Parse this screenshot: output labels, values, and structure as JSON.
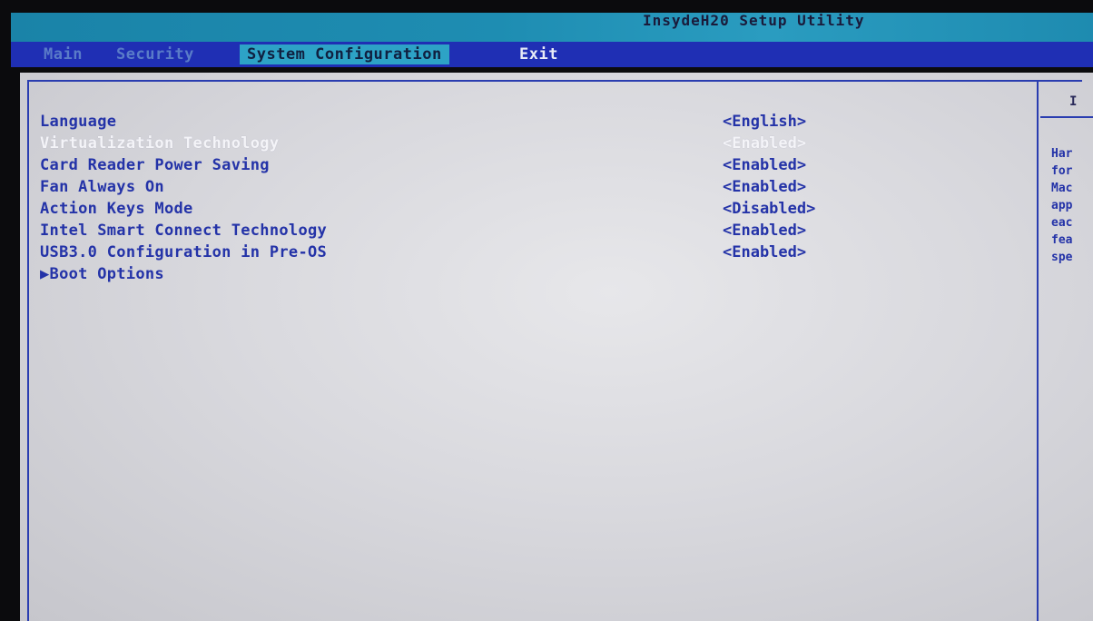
{
  "app": {
    "title": "InsydeH20 Setup Utility"
  },
  "menu": {
    "tabs": [
      {
        "label": "Main"
      },
      {
        "label": "Security"
      },
      {
        "label": "System Configuration"
      },
      {
        "label": "Exit"
      }
    ],
    "active": "System Configuration"
  },
  "settings": [
    {
      "label": "Language",
      "value": "<English>"
    },
    {
      "label": "Virtualization Technology",
      "value": "<Enabled>"
    },
    {
      "label": "Card Reader Power Saving",
      "value": "<Enabled>"
    },
    {
      "label": "Fan Always On",
      "value": "<Enabled>"
    },
    {
      "label": "Action Keys Mode",
      "value": "<Disabled>"
    },
    {
      "label": "Intel Smart Connect Technology",
      "value": "<Enabled>"
    },
    {
      "label": "USB3.0 Configuration in Pre-OS",
      "value": "<Enabled>"
    },
    {
      "label": "▶Boot Options",
      "value": ""
    }
  ],
  "selected_setting": "Virtualization Technology",
  "help": {
    "header": "I",
    "lines": [
      "Har",
      "for",
      "Mac",
      "app",
      "eac",
      "fea",
      "spe"
    ]
  },
  "colors": {
    "menu_bar": "#1f2fb4",
    "title_bar": "#1e8db2",
    "active_tab": "#2da3c6",
    "text_blue": "#2433a8",
    "highlight_text": "#f4f4f8",
    "panel_bg": "#dedee2"
  }
}
